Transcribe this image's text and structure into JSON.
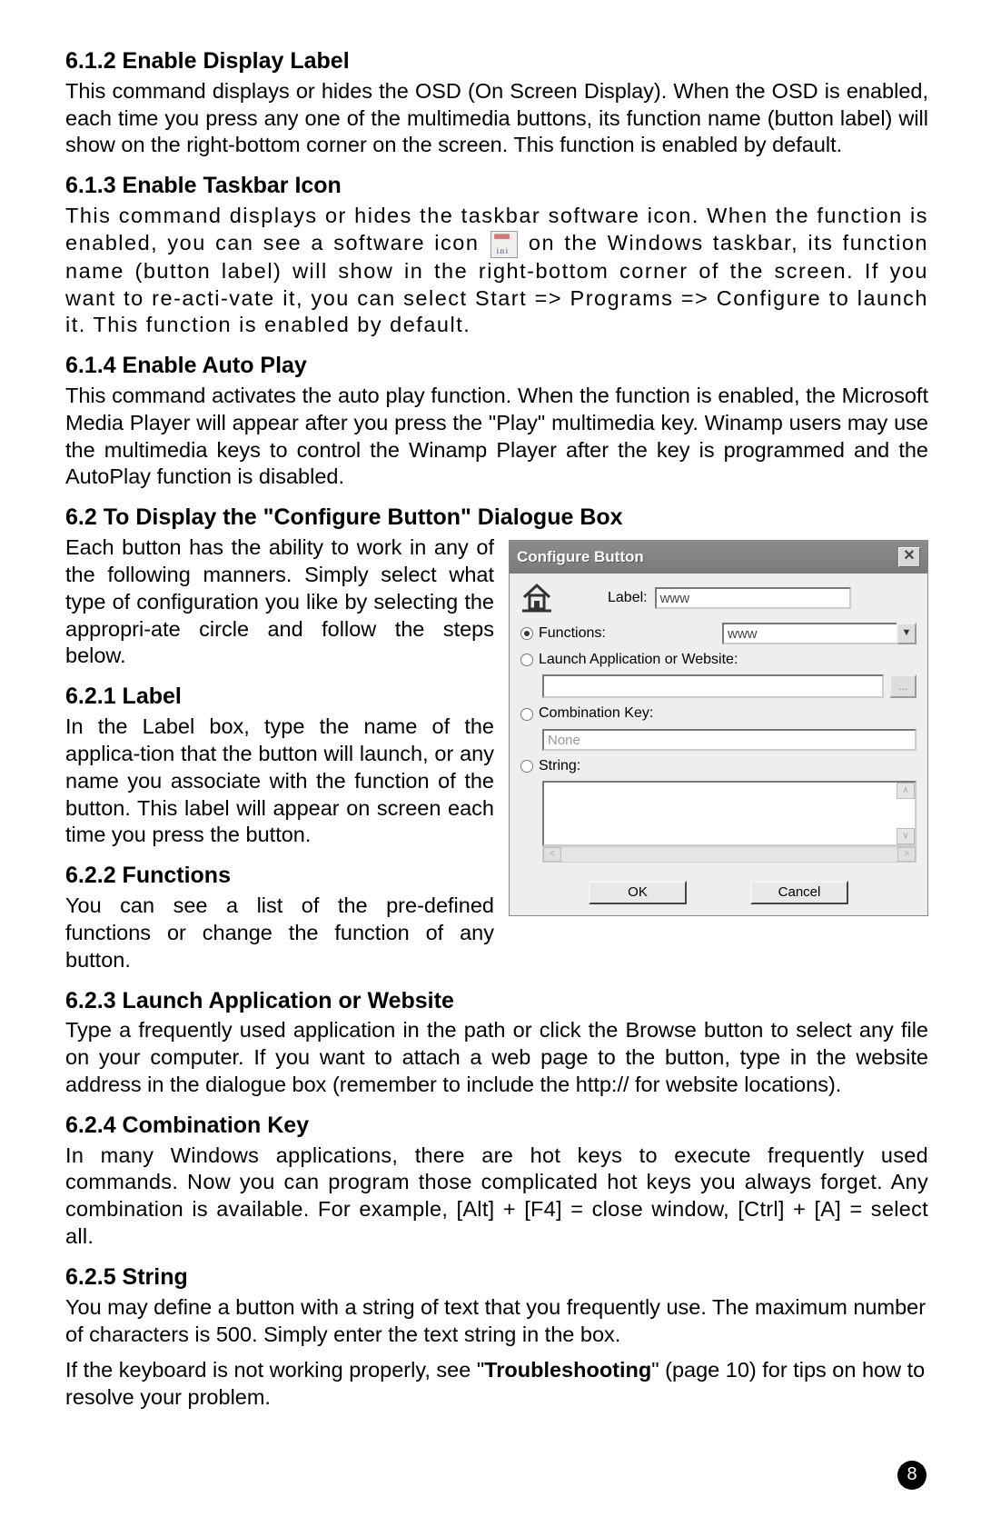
{
  "sections": {
    "s612": {
      "heading": "6.1.2 Enable Display Label",
      "body": "This command displays or hides the OSD (On Screen Display). When the OSD is enabled, each time you press any one of the multimedia buttons, its function name (button label) will show on the right-bottom corner on the screen. This function is enabled by default."
    },
    "s613": {
      "heading": "6.1.3 Enable Taskbar Icon",
      "body_a": "This command displays or hides the taskbar software icon. When the function is enabled, you can see a software icon ",
      "body_b": " on the Windows taskbar, its function name (button label) will show in the right-bottom corner of the screen. If you want to re-acti-vate it, you can select Start => Programs => Configure to launch it. This function is enabled by default."
    },
    "s614": {
      "heading": "6.1.4 Enable Auto Play",
      "body": "This command activates the auto play function. When the function is enabled, the Microsoft Media Player will appear after you press the \"Play\" multimedia key. Winamp users may use the multimedia keys to control the Winamp Player after the key is programmed and the AutoPlay function is disabled."
    },
    "s62": {
      "heading": "6.2 To Display the \"Configure Button\" Dialogue Box",
      "body": "Each button has the ability to work in any of the following manners.  Simply select what type of configuration you like by selecting the appropri-ate circle and follow the steps below."
    },
    "s621": {
      "heading": "6.2.1 Label",
      "body": "In the Label box, type the name of the applica-tion that the button will launch, or any name you associate with the function of the button. This label will appear on screen each time you press the button."
    },
    "s622": {
      "heading": "6.2.2 Functions",
      "body": "You can see a list of the pre-defined functions or change the function of any button."
    },
    "s623": {
      "heading": "6.2.3 Launch Application or Website",
      "body": "Type a frequently used application in the path or click the Browse button to select any file on your computer. If you want to attach a web page to the button, type in the website address in the dialogue box (remember to include the http:// for website locations)."
    },
    "s624": {
      "heading": "6.2.4 Combination Key",
      "body": "In many Windows applications, there are hot keys to execute frequently used commands. Now you can program those complicated hot keys you always forget.  Any combination is available. For example, [Alt] + [F4] = close window,  [Ctrl] + [A] = select all."
    },
    "s625": {
      "heading": "6.2.5 String",
      "body1": "You may define a button with a string of text that you frequently use. The maximum number of characters is 500. Simply enter the text string in the box.",
      "body2a": "If the keyboard is not working properly, see \"",
      "body2bold": "Troubleshooting",
      "body2b": "\"  (page 10) for tips on how to resolve your problem."
    }
  },
  "dialog": {
    "title": "Configure Button",
    "label_label": "Label:",
    "label_value": "www",
    "functions_label": "Functions:",
    "functions_value": "www",
    "launch_label": "Launch Application or Website:",
    "launch_value": "",
    "browse_label": "...",
    "combo_label": "Combination Key:",
    "combo_value": "None",
    "string_label": "String:",
    "ok": "OK",
    "cancel": "Cancel"
  },
  "page_number": "8"
}
